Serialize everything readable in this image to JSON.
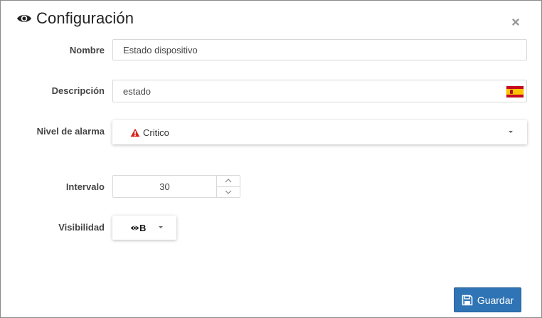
{
  "dialog": {
    "title": "Configuración",
    "title_icon": "eye-icon",
    "close_icon": "close-icon"
  },
  "form": {
    "name": {
      "label": "Nombre",
      "value": "Estado dispositivo"
    },
    "description": {
      "label": "Descripción",
      "value": "estado",
      "flag_icon": "spain-flag-icon"
    },
    "alarm_level": {
      "label": "Nivel de alarma",
      "selected": "Critico",
      "icon": "warning-icon",
      "icon_color": "#d9241b"
    },
    "interval": {
      "label": "Intervalo",
      "value": "30"
    },
    "visibility": {
      "label": "Visibilidad",
      "selected": "B",
      "icon": "eye-icon"
    }
  },
  "footer": {
    "save_label": "Guardar",
    "save_icon": "floppy-disk-icon",
    "save_color": "#2f74b5"
  }
}
